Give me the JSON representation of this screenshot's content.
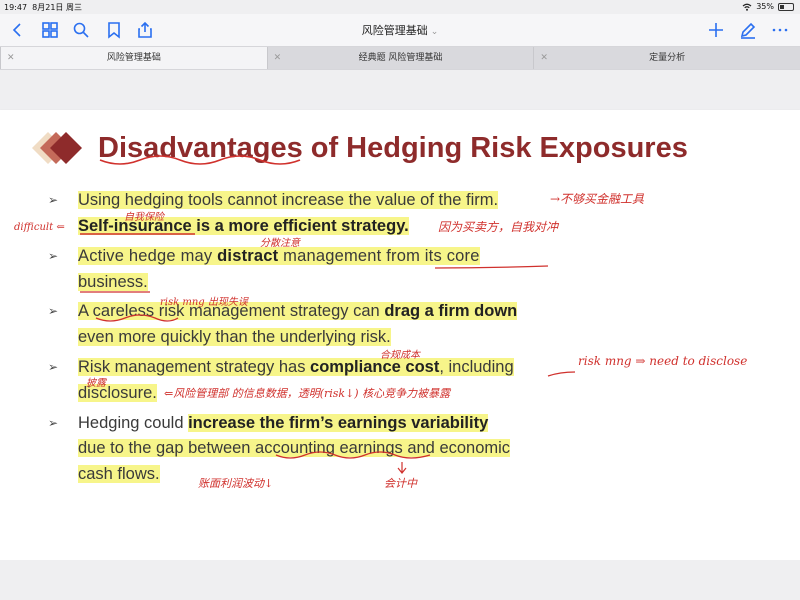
{
  "status_bar": {
    "time": "19:47",
    "date": "8月21日 周三",
    "battery": "35%",
    "battery_level": 0.35
  },
  "toolbar": {
    "title": "风险管理基础"
  },
  "tabs": [
    {
      "label": "风险管理基础",
      "active": true
    },
    {
      "label": "经典题 风险管理基础",
      "active": false
    },
    {
      "label": "定量分析",
      "active": false
    }
  ],
  "slide": {
    "title": "Disadvantages of Hedging Risk Exposures",
    "title_color": "#8e2b2b",
    "bullet_glyph": "➢",
    "b1": {
      "text": "Using hedging tools cannot increase the value of the firm."
    },
    "b1b": {
      "pre": "",
      "bold": "Self-insurance is a more efficient strategy."
    },
    "b2": {
      "l1_pre": "Active hedge may ",
      "l1_bold": "distract",
      "l1_post": " management from its core",
      "l2": "business."
    },
    "b3": {
      "l1_pre": "A careless risk management strategy can ",
      "l1_bold": "drag a firm down",
      "l2": "even more quickly than the underlying risk."
    },
    "b4": {
      "l1_pre": "Risk management strategy has ",
      "l1_bold": "compliance cost",
      "l1_post": ", including",
      "l2": "disclosure."
    },
    "b5": {
      "l1_pre": "Hedging could ",
      "l1_bold": "increase the firm’s earnings variability",
      "l2": "due to the gap between accounting earnings and economic",
      "l3": "cash flows."
    }
  },
  "annotations": {
    "a1": "→不够买金融工具",
    "a2": "自我保险",
    "a3": "difficult ⇐",
    "a4": "因为买卖方，自我对冲",
    "a5": "分散注意",
    "a6": "risk mng 出现失误",
    "a7": "合规成本",
    "a8": "risk mng ⇒ need to disclose",
    "a9": "披露",
    "a10": "⇐风险管理部 的信息数据，透明(risk↓)   核心竞争力被暴露",
    "a11": "账面利润波动↓",
    "a12": "会计中"
  }
}
